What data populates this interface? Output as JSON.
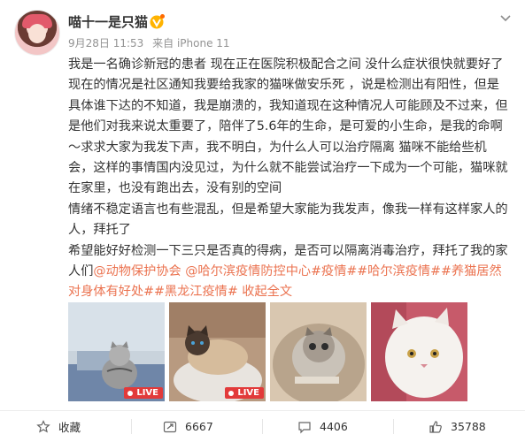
{
  "post": {
    "author": "喵十一是只猫",
    "date": "9月28日 11:53",
    "source": "来自 iPhone 11",
    "paragraphs": [
      {
        "text": "我是一名确诊新冠的患者 现在正在医院积极配合之间 没什么症状很快就要好了现在的情况是社区通知我要给我家的猫咪做安乐死 ，说是检测出有阳性，但是具体谁下达的不知道，我是崩溃的，我知道现在这种情况人可能顾及不过来，但是他们对我来说太重要了，陪伴了5.6年的生命，是可爱的小生命，是我的命啊～求求大家为我发下声，我不明白，为什么人可以治疗隔离 猫咪不能给些机会，这样的事情国内没见过，为什么就不能尝试治疗一下成为一个可能，猫咪就在家里，也没有跑出去，没有别的空间"
      },
      {
        "text": "情绪不稳定语言也有些混乱，但是希望大家能为我发声，像我一样有这样家人的人，拜托了"
      },
      {
        "text": "希望能好好检测一下三只是否真的得病，是否可以隔离消毒治疗，拜托了我的家人们"
      }
    ],
    "tags": [
      "@动物保护协会",
      "@哈尔滨疫情防控中心",
      "#疫情#",
      "#哈尔滨疫情#",
      "#养猫居然对身体有好处#",
      "#黑龙江疫情#"
    ],
    "collapse_label": "收起全文",
    "live_label": "LIVE"
  },
  "footer": {
    "favorite_label": "收藏",
    "repost_count": "6667",
    "comment_count": "4406",
    "like_count": "35788"
  },
  "colors": {
    "link": "#eb7350",
    "live_badge": "#e23a3a",
    "meta": "#939393"
  },
  "icons": [
    "chevron-down-icon",
    "vip-badge-icon",
    "star-icon",
    "repost-icon",
    "comment-icon",
    "like-icon"
  ]
}
